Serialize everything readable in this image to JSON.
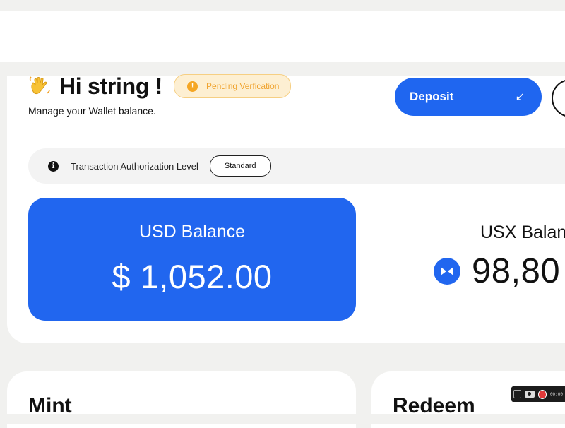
{
  "header": {
    "greeting": "Hi string !",
    "status_badge": "Pending Verfication",
    "subtitle": "Manage your Wallet balance."
  },
  "actions": {
    "deposit_label": "Deposit",
    "deposit_icon": "arrow-down-left-icon"
  },
  "authorization": {
    "label": "Transaction Authorization Level",
    "level": "Standard"
  },
  "balances": {
    "usd": {
      "label": "USD Balance",
      "amount": "$ 1,052.00"
    },
    "usx": {
      "label": "USX Balan",
      "amount": "98,80"
    }
  },
  "sections": {
    "mint_title": "Mint",
    "redeem_title": "Redeem"
  },
  "recorder": {
    "time": "00:00"
  },
  "colors": {
    "primary": "#2166ef",
    "badge_bg": "#fdefd2",
    "badge_text": "#f0a431",
    "page_bg": "#f1f1ef"
  }
}
